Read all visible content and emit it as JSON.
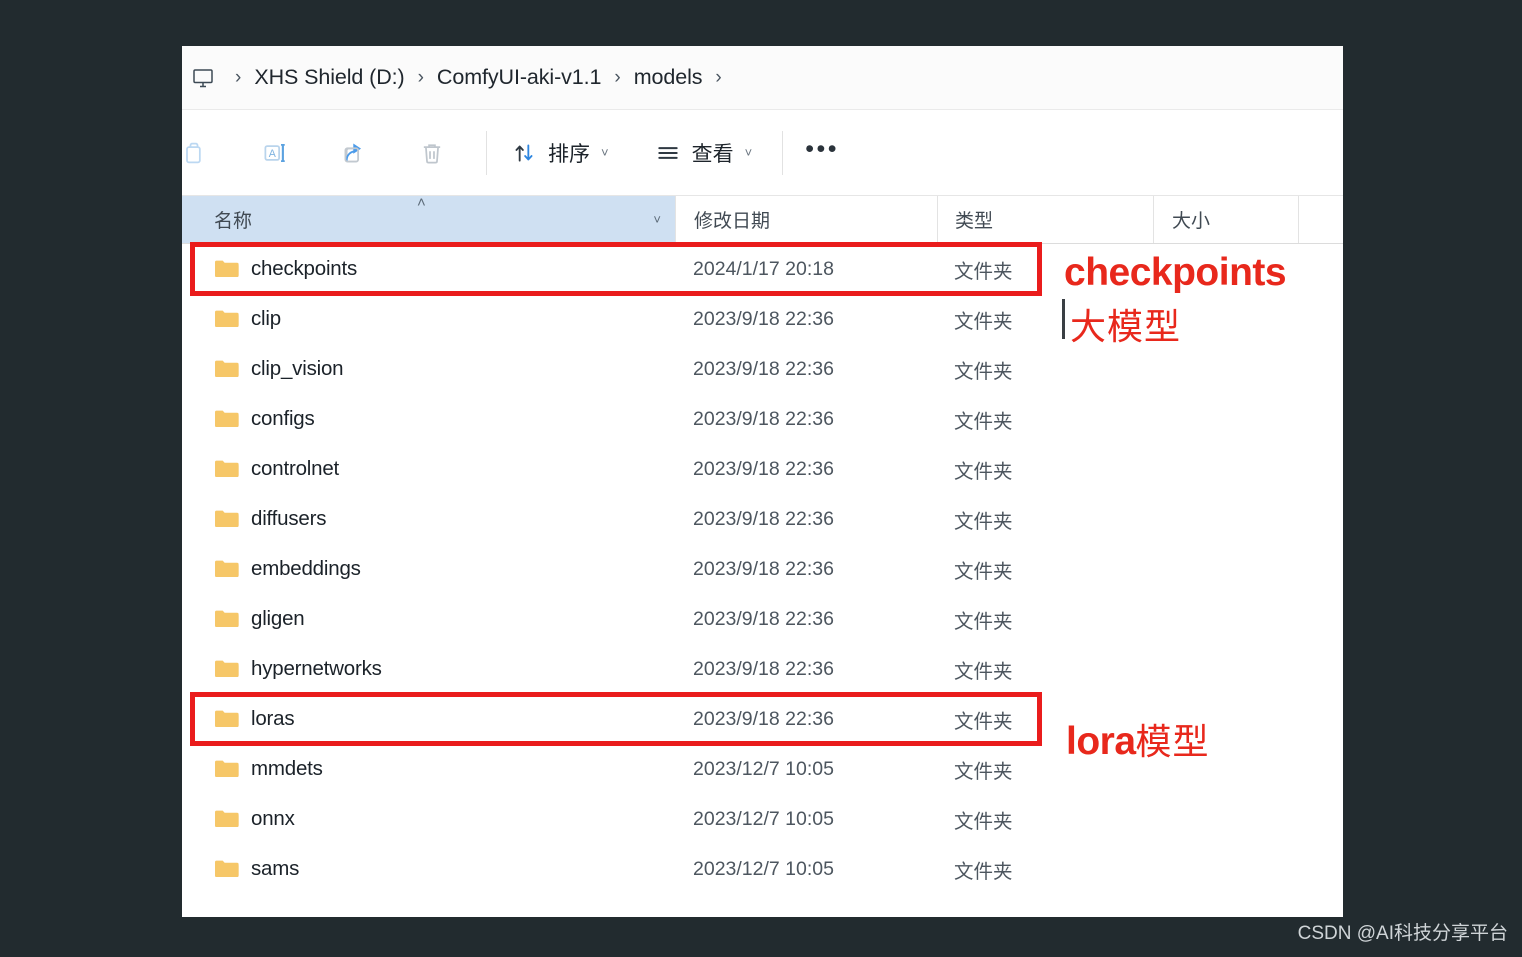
{
  "window": {
    "breadcrumb": {
      "leading_icon": "this-pc-icon",
      "separator": "›",
      "items": [
        "XHS Shield (D:)",
        "ComfyUI-aki-v1.1",
        "models"
      ]
    },
    "toolbar": {
      "icon_buttons": [
        {
          "name": "copy-icon",
          "label": "复制"
        },
        {
          "name": "rename-icon",
          "label": "重命名"
        },
        {
          "name": "share-icon",
          "label": "共享"
        },
        {
          "name": "delete-icon",
          "label": "删除"
        }
      ],
      "sort_label": "排序",
      "view_label": "查看",
      "chevron": "˅",
      "more_label": "•••"
    },
    "columns": {
      "name": "名称",
      "date_modified": "修改日期",
      "type": "类型",
      "size": "大小",
      "sort_caret": "˄",
      "name_chevron": "˅"
    },
    "files": [
      {
        "name": "checkpoints",
        "date": "2024/1/17 20:18",
        "type": "文件夹",
        "size": ""
      },
      {
        "name": "clip",
        "date": "2023/9/18 22:36",
        "type": "文件夹",
        "size": ""
      },
      {
        "name": "clip_vision",
        "date": "2023/9/18 22:36",
        "type": "文件夹",
        "size": ""
      },
      {
        "name": "configs",
        "date": "2023/9/18 22:36",
        "type": "文件夹",
        "size": ""
      },
      {
        "name": "controlnet",
        "date": "2023/9/18 22:36",
        "type": "文件夹",
        "size": ""
      },
      {
        "name": "diffusers",
        "date": "2023/9/18 22:36",
        "type": "文件夹",
        "size": ""
      },
      {
        "name": "embeddings",
        "date": "2023/9/18 22:36",
        "type": "文件夹",
        "size": ""
      },
      {
        "name": "gligen",
        "date": "2023/9/18 22:36",
        "type": "文件夹",
        "size": ""
      },
      {
        "name": "hypernetworks",
        "date": "2023/9/18 22:36",
        "type": "文件夹",
        "size": ""
      },
      {
        "name": "loras",
        "date": "2023/9/18 22:36",
        "type": "文件夹",
        "size": ""
      },
      {
        "name": "mmdets",
        "date": "2023/12/7 10:05",
        "type": "文件夹",
        "size": ""
      },
      {
        "name": "onnx",
        "date": "2023/12/7 10:05",
        "type": "文件夹",
        "size": ""
      },
      {
        "name": "sams",
        "date": "2023/12/7 10:05",
        "type": "文件夹",
        "size": ""
      }
    ]
  },
  "annotations": [
    {
      "latin": "checkpoints",
      "cjk": "大模型",
      "target_row": "checkpoints"
    },
    {
      "latin": "lora",
      "cjk": "模型",
      "target_row": "loras"
    }
  ],
  "watermark": "CSDN @AI科技分享平台",
  "colors": {
    "background": "#222b2f",
    "highlight_red": "#ea1c1c",
    "annotation_red": "#e8281c",
    "folder": "#f6c768",
    "header_selected": "#cfe0f2",
    "accent_blue": "#4b9bea"
  }
}
